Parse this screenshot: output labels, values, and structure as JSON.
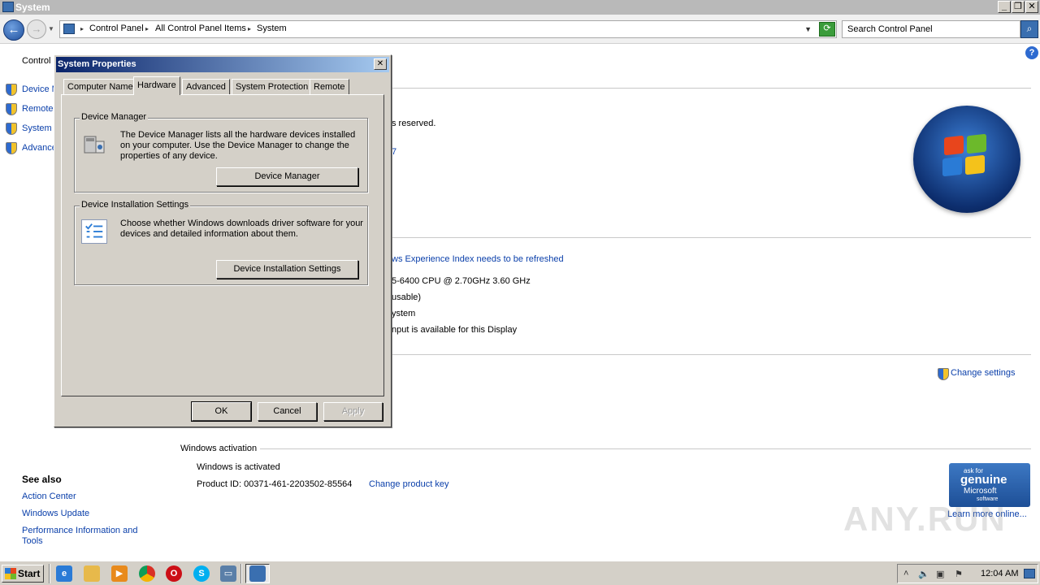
{
  "window": {
    "title": "System"
  },
  "address": {
    "crumbs": [
      "Control Panel",
      "All Control Panel Items",
      "System"
    ],
    "search_placeholder": "Search Control Panel"
  },
  "left_panel": {
    "home": "Control",
    "tasks": [
      "Device M",
      "Remote",
      "System",
      "Advance"
    ],
    "see_also_title": "See also",
    "see_also": [
      "Action Center",
      "Windows Update",
      "Performance Information and Tools"
    ]
  },
  "main": {
    "reserved": "s reserved.",
    "frag7": "7",
    "wei_link": "ws Experience Index needs to be refreshed",
    "cpu": "5-6400 CPU @ 2.70GHz   3.60 GHz",
    "ram": "usable)",
    "systype": "ystem",
    "pen": "nput is available for this Display",
    "change_settings": "Change settings",
    "activation_title": "Windows activation",
    "activated": "Windows is activated",
    "product_id": "Product ID:  00371-461-2203502-85564",
    "change_key": "Change product key",
    "genuine": {
      "line1": "ask for",
      "line2": "genuine",
      "line3": "Microsoft",
      "line4": "software"
    },
    "learn_more": "Learn more online..."
  },
  "dialog": {
    "title": "System Properties",
    "tabs": [
      "Computer Name",
      "Hardware",
      "Advanced",
      "System Protection",
      "Remote"
    ],
    "device_manager": {
      "title": "Device Manager",
      "text": "The Device Manager lists all the hardware devices installed on your computer. Use the Device Manager to change the properties of any device.",
      "button": "Device Manager"
    },
    "installation": {
      "title": "Device Installation Settings",
      "text": "Choose whether Windows downloads driver software for your devices and detailed information about them.",
      "button": "Device Installation Settings"
    },
    "buttons": {
      "ok": "OK",
      "cancel": "Cancel",
      "apply": "Apply"
    }
  },
  "taskbar": {
    "start": "Start",
    "clock": "12:04 AM"
  },
  "watermark": "ANY.RUN"
}
